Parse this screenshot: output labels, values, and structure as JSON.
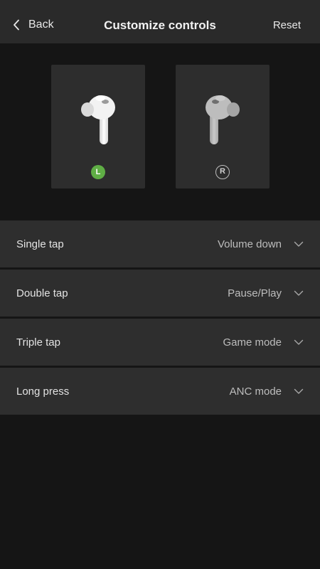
{
  "header": {
    "back_label": "Back",
    "title": "Customize controls",
    "reset_label": "Reset"
  },
  "earbuds": {
    "left": {
      "badge": "L",
      "selected": true
    },
    "right": {
      "badge": "R",
      "selected": false
    }
  },
  "controls": [
    {
      "label": "Single tap",
      "value": "Volume down"
    },
    {
      "label": "Double tap",
      "value": "Pause/Play"
    },
    {
      "label": "Triple tap",
      "value": "Game mode"
    },
    {
      "label": "Long press",
      "value": "ANC mode"
    }
  ],
  "colors": {
    "accent": "#5fae45",
    "header_bg": "#2a2a2a",
    "row_bg": "#2e2e2e",
    "page_bg": "#151515"
  },
  "icons": {
    "back": "chevron-left-icon",
    "dropdown": "chevron-down-icon"
  }
}
